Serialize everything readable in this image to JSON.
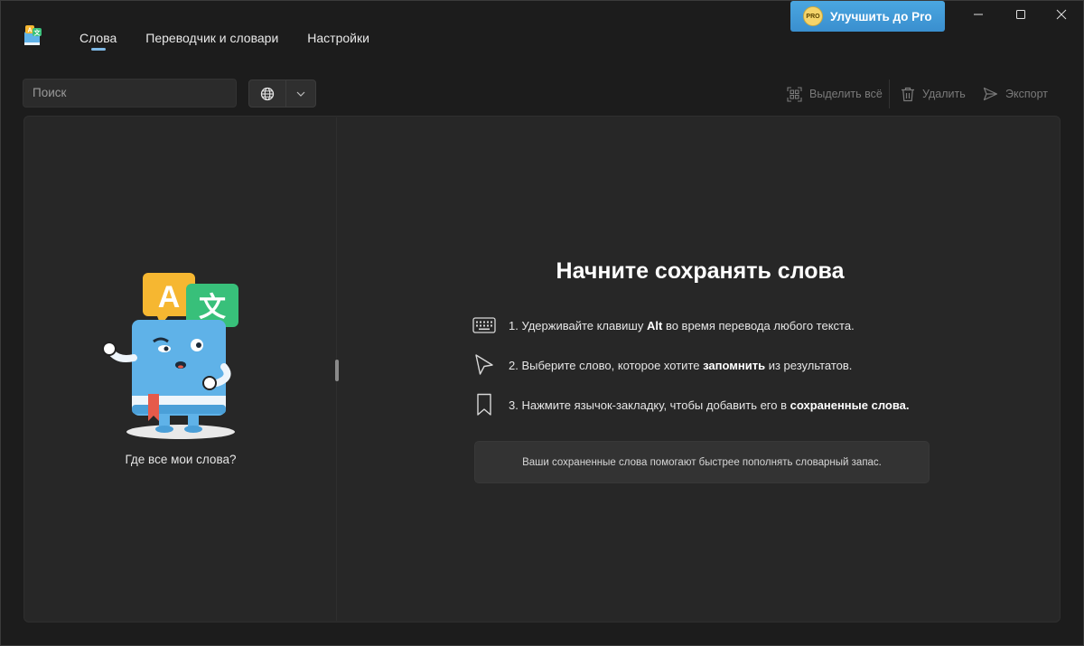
{
  "nav": {
    "tabs": [
      {
        "label": "Слова",
        "active": true
      },
      {
        "label": "Переводчик и словари",
        "active": false
      },
      {
        "label": "Настройки",
        "active": false
      }
    ]
  },
  "pro": {
    "badge": "PRO",
    "label": "Улучшить до Pro"
  },
  "window_controls": [
    "minimize-icon",
    "maximize-icon",
    "close-icon"
  ],
  "toolbar": {
    "search_placeholder": "Поиск",
    "select_all": "Выделить всё",
    "delete": "Удалить",
    "export": "Экспорт"
  },
  "left": {
    "caption": "Где все мои слова?"
  },
  "right": {
    "heading": "Начните сохранять слова",
    "steps": [
      {
        "icon": "keyboard-icon",
        "pre": "1. Удерживайте клавишу ",
        "bold": "Alt",
        "post": " во время перевода любого текста."
      },
      {
        "icon": "cursor-icon",
        "pre": "2. Выберите слово, которое хотите ",
        "bold": "запомнить",
        "post": " из результатов."
      },
      {
        "icon": "bookmark-icon",
        "pre": "3. Нажмите язычок-закладку, чтобы добавить его в ",
        "bold": "сохраненные слова.",
        "post": ""
      }
    ],
    "tip": "Ваши сохраненные слова помогают быстрее пополнять словарный запас."
  },
  "colors": {
    "accent": "#3a8fcf",
    "tab_underline": "#7fb9e6",
    "background": "#1c1c1c",
    "panel": "#272727"
  }
}
